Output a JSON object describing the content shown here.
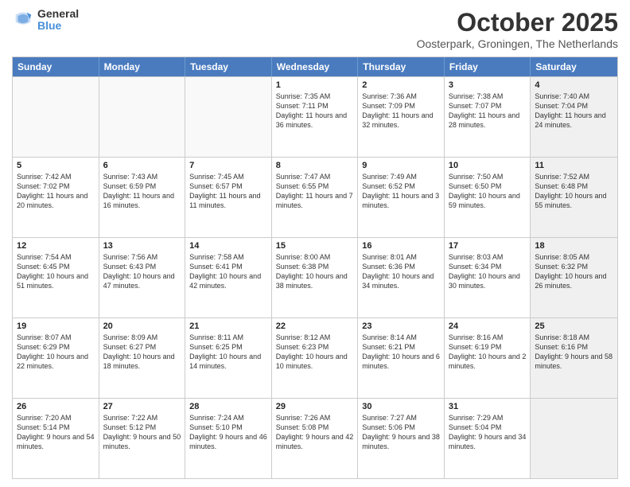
{
  "header": {
    "logo_general": "General",
    "logo_blue": "Blue",
    "main_title": "October 2025",
    "subtitle": "Oosterpark, Groningen, The Netherlands"
  },
  "calendar": {
    "days": [
      "Sunday",
      "Monday",
      "Tuesday",
      "Wednesday",
      "Thursday",
      "Friday",
      "Saturday"
    ],
    "rows": [
      [
        {
          "day": "",
          "text": "",
          "empty": true
        },
        {
          "day": "",
          "text": "",
          "empty": true
        },
        {
          "day": "",
          "text": "",
          "empty": true
        },
        {
          "day": "1",
          "text": "Sunrise: 7:35 AM\nSunset: 7:11 PM\nDaylight: 11 hours and 36 minutes.",
          "empty": false
        },
        {
          "day": "2",
          "text": "Sunrise: 7:36 AM\nSunset: 7:09 PM\nDaylight: 11 hours and 32 minutes.",
          "empty": false
        },
        {
          "day": "3",
          "text": "Sunrise: 7:38 AM\nSunset: 7:07 PM\nDaylight: 11 hours and 28 minutes.",
          "empty": false
        },
        {
          "day": "4",
          "text": "Sunrise: 7:40 AM\nSunset: 7:04 PM\nDaylight: 11 hours and 24 minutes.",
          "empty": false,
          "shaded": true
        }
      ],
      [
        {
          "day": "5",
          "text": "Sunrise: 7:42 AM\nSunset: 7:02 PM\nDaylight: 11 hours and 20 minutes.",
          "empty": false
        },
        {
          "day": "6",
          "text": "Sunrise: 7:43 AM\nSunset: 6:59 PM\nDaylight: 11 hours and 16 minutes.",
          "empty": false
        },
        {
          "day": "7",
          "text": "Sunrise: 7:45 AM\nSunset: 6:57 PM\nDaylight: 11 hours and 11 minutes.",
          "empty": false
        },
        {
          "day": "8",
          "text": "Sunrise: 7:47 AM\nSunset: 6:55 PM\nDaylight: 11 hours and 7 minutes.",
          "empty": false
        },
        {
          "day": "9",
          "text": "Sunrise: 7:49 AM\nSunset: 6:52 PM\nDaylight: 11 hours and 3 minutes.",
          "empty": false
        },
        {
          "day": "10",
          "text": "Sunrise: 7:50 AM\nSunset: 6:50 PM\nDaylight: 10 hours and 59 minutes.",
          "empty": false
        },
        {
          "day": "11",
          "text": "Sunrise: 7:52 AM\nSunset: 6:48 PM\nDaylight: 10 hours and 55 minutes.",
          "empty": false,
          "shaded": true
        }
      ],
      [
        {
          "day": "12",
          "text": "Sunrise: 7:54 AM\nSunset: 6:45 PM\nDaylight: 10 hours and 51 minutes.",
          "empty": false
        },
        {
          "day": "13",
          "text": "Sunrise: 7:56 AM\nSunset: 6:43 PM\nDaylight: 10 hours and 47 minutes.",
          "empty": false
        },
        {
          "day": "14",
          "text": "Sunrise: 7:58 AM\nSunset: 6:41 PM\nDaylight: 10 hours and 42 minutes.",
          "empty": false
        },
        {
          "day": "15",
          "text": "Sunrise: 8:00 AM\nSunset: 6:38 PM\nDaylight: 10 hours and 38 minutes.",
          "empty": false
        },
        {
          "day": "16",
          "text": "Sunrise: 8:01 AM\nSunset: 6:36 PM\nDaylight: 10 hours and 34 minutes.",
          "empty": false
        },
        {
          "day": "17",
          "text": "Sunrise: 8:03 AM\nSunset: 6:34 PM\nDaylight: 10 hours and 30 minutes.",
          "empty": false
        },
        {
          "day": "18",
          "text": "Sunrise: 8:05 AM\nSunset: 6:32 PM\nDaylight: 10 hours and 26 minutes.",
          "empty": false,
          "shaded": true
        }
      ],
      [
        {
          "day": "19",
          "text": "Sunrise: 8:07 AM\nSunset: 6:29 PM\nDaylight: 10 hours and 22 minutes.",
          "empty": false
        },
        {
          "day": "20",
          "text": "Sunrise: 8:09 AM\nSunset: 6:27 PM\nDaylight: 10 hours and 18 minutes.",
          "empty": false
        },
        {
          "day": "21",
          "text": "Sunrise: 8:11 AM\nSunset: 6:25 PM\nDaylight: 10 hours and 14 minutes.",
          "empty": false
        },
        {
          "day": "22",
          "text": "Sunrise: 8:12 AM\nSunset: 6:23 PM\nDaylight: 10 hours and 10 minutes.",
          "empty": false
        },
        {
          "day": "23",
          "text": "Sunrise: 8:14 AM\nSunset: 6:21 PM\nDaylight: 10 hours and 6 minutes.",
          "empty": false
        },
        {
          "day": "24",
          "text": "Sunrise: 8:16 AM\nSunset: 6:19 PM\nDaylight: 10 hours and 2 minutes.",
          "empty": false
        },
        {
          "day": "25",
          "text": "Sunrise: 8:18 AM\nSunset: 6:16 PM\nDaylight: 9 hours and 58 minutes.",
          "empty": false,
          "shaded": true
        }
      ],
      [
        {
          "day": "26",
          "text": "Sunrise: 7:20 AM\nSunset: 5:14 PM\nDaylight: 9 hours and 54 minutes.",
          "empty": false
        },
        {
          "day": "27",
          "text": "Sunrise: 7:22 AM\nSunset: 5:12 PM\nDaylight: 9 hours and 50 minutes.",
          "empty": false
        },
        {
          "day": "28",
          "text": "Sunrise: 7:24 AM\nSunset: 5:10 PM\nDaylight: 9 hours and 46 minutes.",
          "empty": false
        },
        {
          "day": "29",
          "text": "Sunrise: 7:26 AM\nSunset: 5:08 PM\nDaylight: 9 hours and 42 minutes.",
          "empty": false
        },
        {
          "day": "30",
          "text": "Sunrise: 7:27 AM\nSunset: 5:06 PM\nDaylight: 9 hours and 38 minutes.",
          "empty": false
        },
        {
          "day": "31",
          "text": "Sunrise: 7:29 AM\nSunset: 5:04 PM\nDaylight: 9 hours and 34 minutes.",
          "empty": false
        },
        {
          "day": "",
          "text": "",
          "empty": true,
          "shaded": true
        }
      ]
    ]
  }
}
